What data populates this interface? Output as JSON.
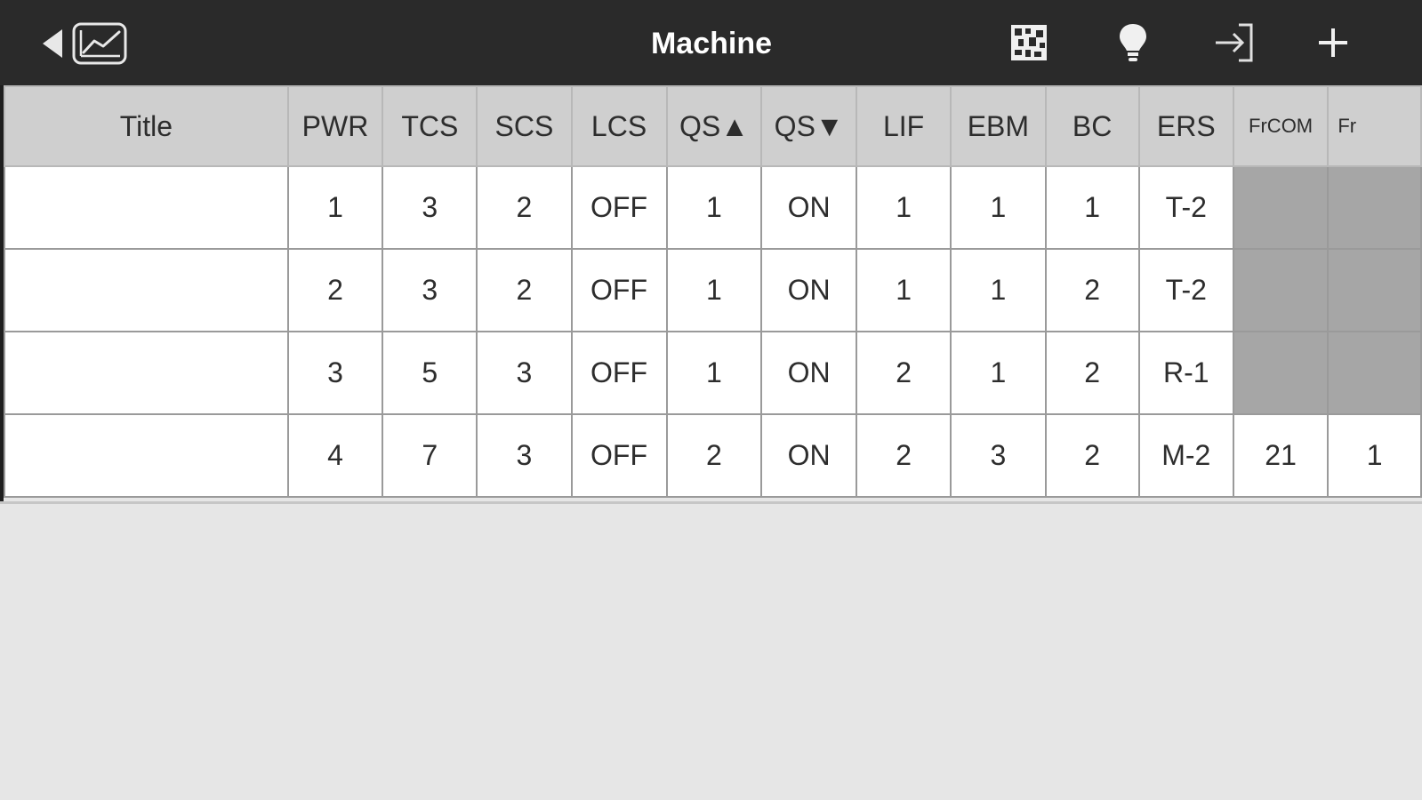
{
  "header": {
    "title": "Machine",
    "icons": [
      "back-arrow-icon",
      "chart-icon",
      "grid-pattern-icon",
      "lightbulb-icon",
      "sign-in-icon",
      "plus-icon"
    ]
  },
  "table": {
    "columns": [
      "Title",
      "PWR",
      "TCS",
      "SCS",
      "LCS",
      "QS▲",
      "QS▼",
      "LIF",
      "EBM",
      "BC",
      "ERS",
      "FrCOM",
      "Fr"
    ],
    "rows": [
      {
        "title": "",
        "pwr": "1",
        "tcs": "3",
        "scs": "2",
        "lcs": "OFF",
        "qs_up": "1",
        "qs_down": "ON",
        "lif": "1",
        "ebm": "1",
        "bc": "1",
        "ers": "T-2",
        "frcom": "",
        "fr": ""
      },
      {
        "title": "",
        "pwr": "2",
        "tcs": "3",
        "scs": "2",
        "lcs": "OFF",
        "qs_up": "1",
        "qs_down": "ON",
        "lif": "1",
        "ebm": "1",
        "bc": "2",
        "ers": "T-2",
        "frcom": "",
        "fr": ""
      },
      {
        "title": "",
        "pwr": "3",
        "tcs": "5",
        "scs": "3",
        "lcs": "OFF",
        "qs_up": "1",
        "qs_down": "ON",
        "lif": "2",
        "ebm": "1",
        "bc": "2",
        "ers": "R-1",
        "frcom": "",
        "fr": ""
      },
      {
        "title": "",
        "pwr": "4",
        "tcs": "7",
        "scs": "3",
        "lcs": "OFF",
        "qs_up": "2",
        "qs_down": "ON",
        "lif": "2",
        "ebm": "3",
        "bc": "2",
        "ers": "M-2",
        "frcom": "21",
        "fr": "1"
      }
    ]
  },
  "colors": {
    "topbar": "#2a2a2a",
    "header_cell": "#cfcfcf",
    "shaded_cell": "#a6a6a6",
    "background": "#e6e6e6"
  }
}
